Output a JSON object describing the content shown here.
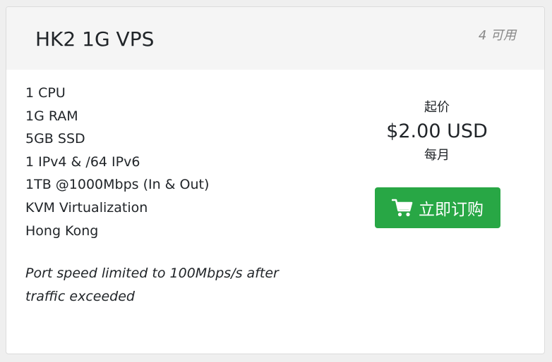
{
  "product": {
    "name": "HK2 1G VPS",
    "availability": "4 可用",
    "features": [
      "1 CPU",
      "1G RAM",
      "5GB SSD",
      "1 IPv4 & /64 IPv6",
      "1TB @1000Mbps (In & Out)",
      "KVM Virtualization",
      "Hong Kong"
    ],
    "note": "Port speed limited to 100Mbps/s after traffic exceeded"
  },
  "pricing": {
    "from_label": "起价",
    "amount": "$2.00 USD",
    "cycle": "每月"
  },
  "order_button": {
    "label": "立即订购",
    "icon": "shopping-cart-icon",
    "color": "#28a745"
  },
  "colors": {
    "header_background": "#f5f5f5",
    "availability_text": "#888888"
  }
}
